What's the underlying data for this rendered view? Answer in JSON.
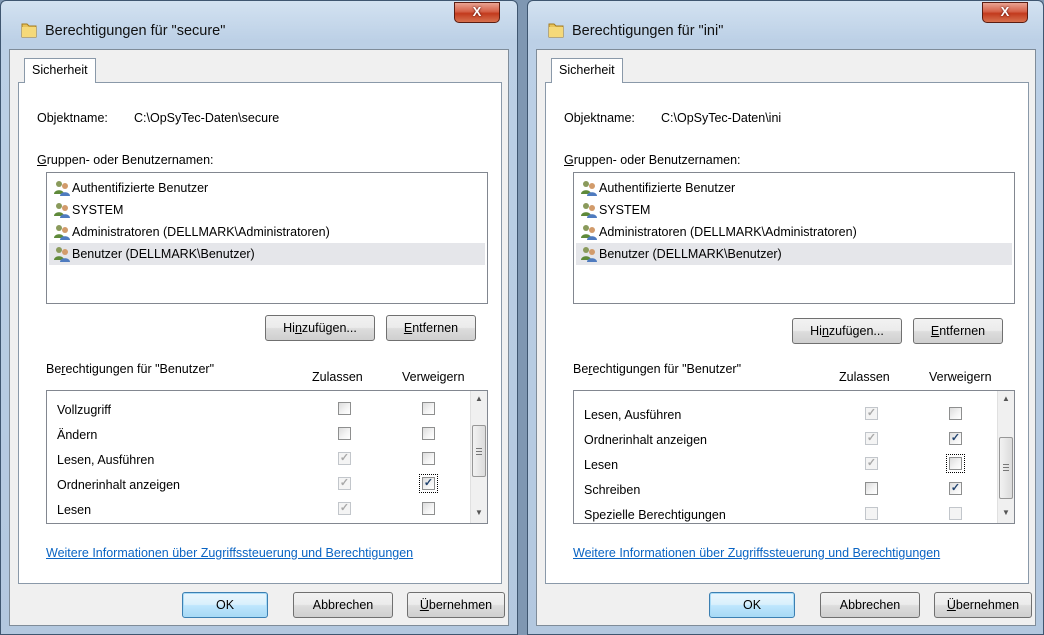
{
  "windows": [
    {
      "title": "Berechtigungen für \"secure\"",
      "close_label": "X",
      "tab": "Sicherheit",
      "object_label": "Objektname:",
      "object_value": "C:\\OpSyTec-Daten\\secure",
      "groups_label_pre": "G",
      "groups_label_rest": "ruppen- oder Benutzernamen:",
      "users": [
        {
          "label": "Authentifizierte Benutzer",
          "selected": false
        },
        {
          "label": "SYSTEM",
          "selected": false
        },
        {
          "label": "Administratoren (DELLMARK\\Administratoren)",
          "selected": false
        },
        {
          "label": "Benutzer (DELLMARK\\Benutzer)",
          "selected": true
        }
      ],
      "add_pre": "Hi",
      "add_u": "n",
      "add_post": "zufügen...",
      "remove_u": "E",
      "remove_post": "ntfernen",
      "perm_label_pre": "Be",
      "perm_label_u": "r",
      "perm_label_post": "echtigungen für \"Benutzer\"",
      "col_allow": "Zulassen",
      "col_deny": "Verweigern",
      "permissions": [
        {
          "label": "Vollzugriff",
          "allow": "unchecked",
          "deny": "unchecked"
        },
        {
          "label": "Ändern",
          "allow": "unchecked",
          "deny": "unchecked"
        },
        {
          "label": "Lesen, Ausführen",
          "allow": "disabled-checked",
          "deny": "unchecked"
        },
        {
          "label": "Ordnerinhalt anzeigen",
          "allow": "disabled-checked",
          "deny": "checked-focus"
        },
        {
          "label": "Lesen",
          "allow": "disabled-checked",
          "deny": "unchecked"
        }
      ],
      "link": "Weitere Informationen über Zugriffssteuerung und Berechtigungen",
      "ok": "OK",
      "cancel": "Abbrechen",
      "apply_u": "Ü",
      "apply_post": "bernehmen"
    },
    {
      "title": "Berechtigungen für \"ini\"",
      "close_label": "X",
      "tab": "Sicherheit",
      "object_label": "Objektname:",
      "object_value": "C:\\OpSyTec-Daten\\ini",
      "groups_label_pre": "G",
      "groups_label_rest": "ruppen- oder Benutzernamen:",
      "users": [
        {
          "label": "Authentifizierte Benutzer",
          "selected": false
        },
        {
          "label": "SYSTEM",
          "selected": false
        },
        {
          "label": "Administratoren (DELLMARK\\Administratoren)",
          "selected": false
        },
        {
          "label": "Benutzer (DELLMARK\\Benutzer)",
          "selected": true
        }
      ],
      "add_pre": "Hi",
      "add_u": "n",
      "add_post": "zufügen...",
      "remove_u": "E",
      "remove_post": "ntfernen",
      "perm_label_pre": "Be",
      "perm_label_u": "r",
      "perm_label_post": "echtigungen für \"Benutzer\"",
      "col_allow": "Zulassen",
      "col_deny": "Verweigern",
      "permissions": [
        {
          "label": "Lesen, Ausführen",
          "allow": "disabled-checked",
          "deny": "unchecked"
        },
        {
          "label": "Ordnerinhalt anzeigen",
          "allow": "disabled-checked",
          "deny": "checked"
        },
        {
          "label": "Lesen",
          "allow": "disabled-checked",
          "deny": "unchecked-focus"
        },
        {
          "label": "Schreiben",
          "allow": "unchecked",
          "deny": "checked"
        },
        {
          "label": "Spezielle Berechtigungen",
          "allow": "disabled",
          "deny": "disabled"
        }
      ],
      "link": "Weitere Informationen über Zugriffssteuerung und Berechtigungen",
      "ok": "OK",
      "cancel": "Abbrechen",
      "apply_u": "Ü",
      "apply_post": "bernehmen"
    }
  ],
  "icons": {
    "folder": "folder-icon",
    "user_group": "user-group-icon",
    "check": "✓"
  },
  "colors": {
    "link": "#0a64c3",
    "close": "#c23a1d",
    "titlebar": "#bcd0e6"
  }
}
